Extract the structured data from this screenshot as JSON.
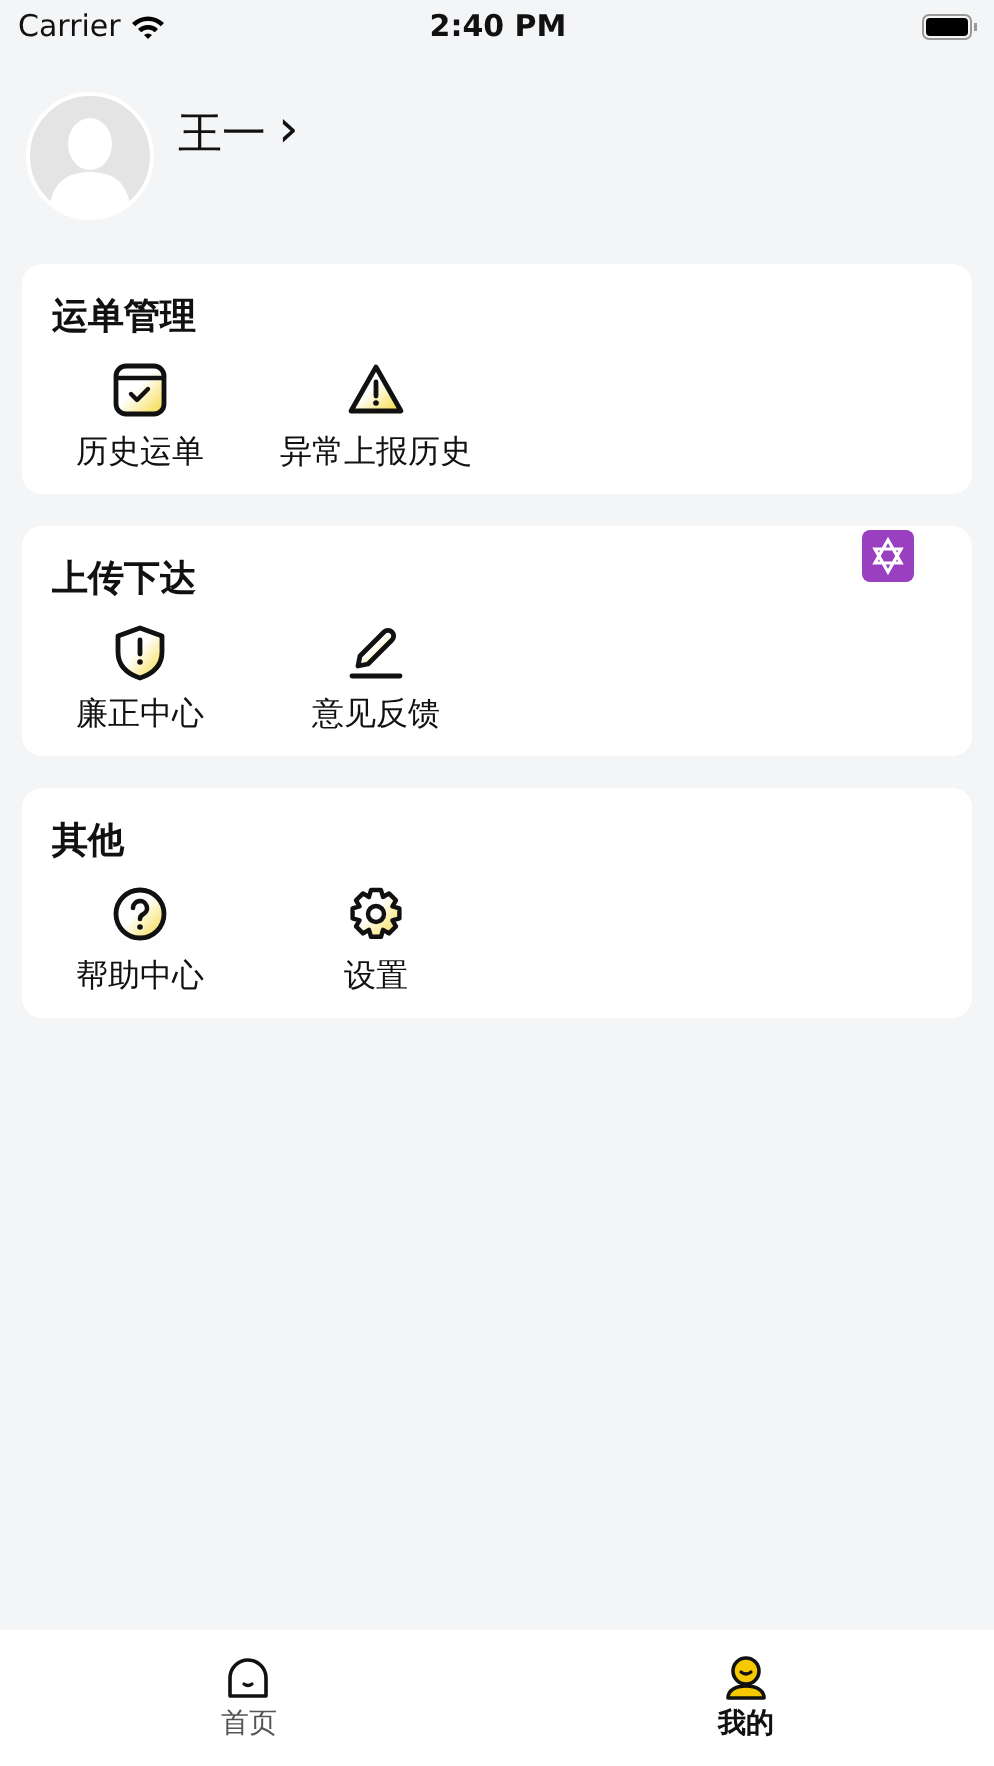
{
  "status_bar": {
    "carrier": "Carrier",
    "time": "2:40 PM"
  },
  "profile": {
    "name": "王一",
    "chevron": "›"
  },
  "sections": [
    {
      "title": "运单管理",
      "items": [
        {
          "label": "历史运单",
          "kind": "calendar"
        },
        {
          "label": "异常上报历史",
          "kind": "warning"
        }
      ]
    },
    {
      "title": "上传下达",
      "items": [
        {
          "label": "廉正中心",
          "kind": "shield"
        },
        {
          "label": "意见反馈",
          "kind": "pen"
        }
      ]
    },
    {
      "title": "其他",
      "items": [
        {
          "label": "帮助中心",
          "kind": "help"
        },
        {
          "label": "设置",
          "kind": "gear"
        }
      ]
    }
  ],
  "tabs": [
    {
      "label": "首页",
      "kind": "home",
      "selected": false
    },
    {
      "label": "我的",
      "kind": "me",
      "selected": true
    }
  ]
}
